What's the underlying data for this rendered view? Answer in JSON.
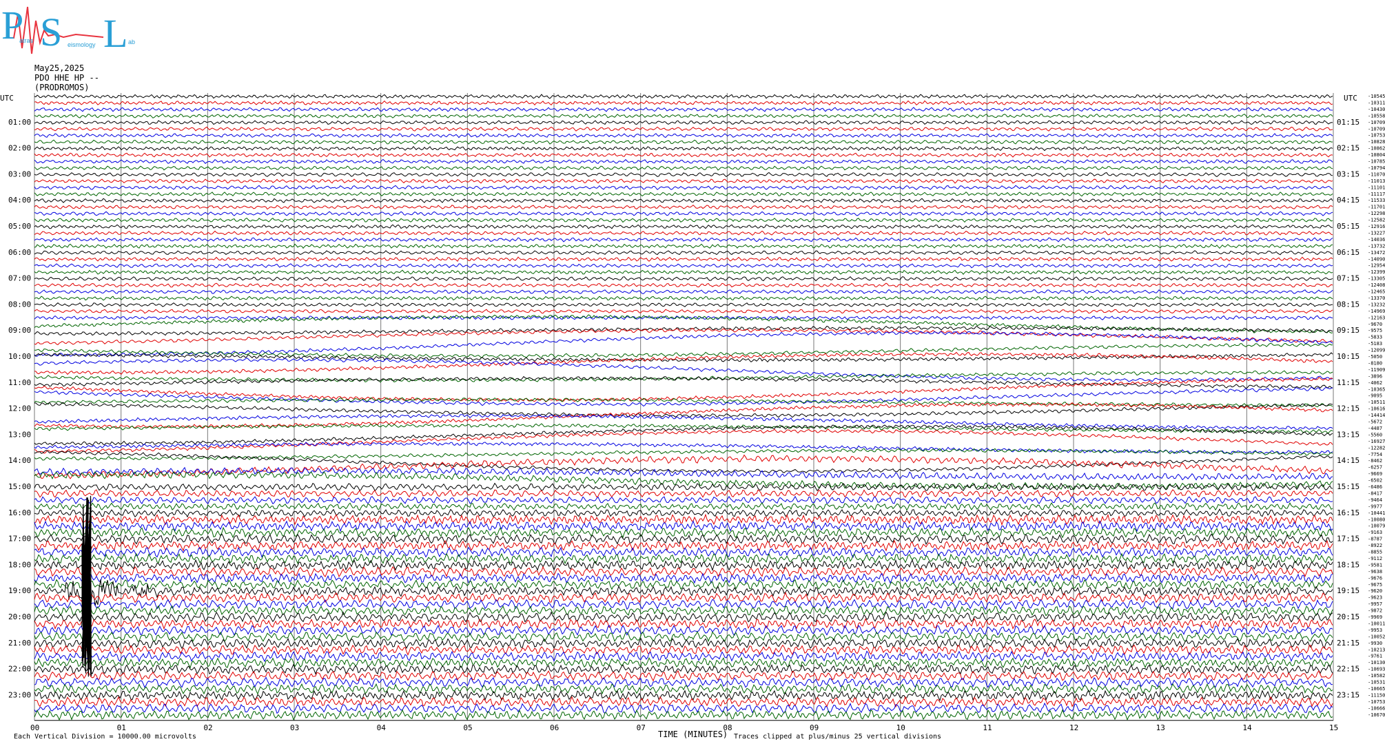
{
  "header": {
    "date": "May25,2025",
    "station": "PDO HHE HP --",
    "site": "(PRODROMOS)"
  },
  "logo": {
    "letters": [
      "P",
      "S",
      "L"
    ],
    "small_text": [
      "atras",
      "eismology",
      "ab"
    ],
    "colors": {
      "letters": "#2a9fd6",
      "spike": "#e8343f"
    }
  },
  "axes": {
    "left_corner": "UTC",
    "right_corner": "UTC",
    "xlabel": "TIME (MINUTES)"
  },
  "footer": {
    "vertical_division": "Each Vertical Division = 10000.00 microvolts",
    "clip_note": "Traces clipped at plus/minus 25 vertical divisions"
  },
  "colors": {
    "trace_cycle": [
      "#000000",
      "#e00000",
      "#0000e0",
      "#006400"
    ],
    "grid": "#777777",
    "background": "#ffffff"
  },
  "chart_data": {
    "type": "line",
    "subtype": "helicorder",
    "x_unit": "minutes",
    "xlim": [
      0,
      15
    ],
    "x_ticks": [
      "00",
      "01",
      "02",
      "03",
      "04",
      "05",
      "06",
      "07",
      "08",
      "09",
      "10",
      "11",
      "12",
      "13",
      "14",
      "15"
    ],
    "grid": true,
    "traces_per_hour": 4,
    "trace_count": 96,
    "left_hour_labels": [
      "01:00",
      "02:00",
      "03:00",
      "04:00",
      "05:00",
      "06:00",
      "07:00",
      "08:00",
      "09:00",
      "10:00",
      "11:00",
      "12:00",
      "13:00",
      "14:00",
      "15:00",
      "16:00",
      "17:00",
      "18:00",
      "19:00",
      "20:00",
      "21:00",
      "22:00",
      "23:00"
    ],
    "right_hour_labels": [
      "01:15",
      "02:15",
      "03:15",
      "04:15",
      "05:15",
      "06:15",
      "07:15",
      "08:15",
      "09:15",
      "10:15",
      "11:15",
      "12:15",
      "13:15",
      "14:15",
      "15:15",
      "16:15",
      "17:15",
      "18:15",
      "19:15",
      "20:15",
      "21:15",
      "22:15",
      "23:15"
    ],
    "trace_offsets": [
      "-10545",
      "-10311",
      "-10430",
      "-10558",
      "-10709",
      "-10709",
      "-10753",
      "-10828",
      "-10862",
      "-10804",
      "-10785",
      "-10794",
      "-11070",
      "-11013",
      "-11101",
      "-11117",
      "-11533",
      "-11701",
      "-12298",
      "-12582",
      "-12916",
      "-13227",
      "-14036",
      "-13732",
      "-13472",
      "-14090",
      "-12954",
      "-12399",
      "-13305",
      "-12408",
      "-12465",
      "-13370",
      "-13232",
      "-14969",
      "-12163",
      "-9670",
      "-9575",
      "-5833",
      "-5183",
      "-12099",
      "-5050",
      "-8180",
      "-11909",
      "-3896",
      "-4062",
      "-10365",
      "-9095",
      "-10511",
      "-10616",
      "-14414",
      "-5672",
      "-4487",
      "-5560",
      "-16927",
      "-12282",
      "-7754",
      "-8462",
      "-6257",
      "-9669",
      "-6502",
      "-6486",
      "-8417",
      "-9464",
      "-9977",
      "-10441",
      "-10080",
      "-10079",
      "-9163",
      "-8787",
      "-8922",
      "-8855",
      "-9112",
      "-9581",
      "-9638",
      "-9676",
      "-9675",
      "-9620",
      "-9623",
      "-9957",
      "-9872",
      "-9969",
      "-10011",
      "-9953",
      "-10052",
      "-9930",
      "-10213",
      "-9761",
      "-10130",
      "-10693",
      "-10582",
      "-10531",
      "-10665",
      "-11150",
      "-10753",
      "-10666",
      "-10670"
    ],
    "events": [
      {
        "hour_label": "19:00",
        "minute": 0.6,
        "description_visible": false
      }
    ]
  }
}
